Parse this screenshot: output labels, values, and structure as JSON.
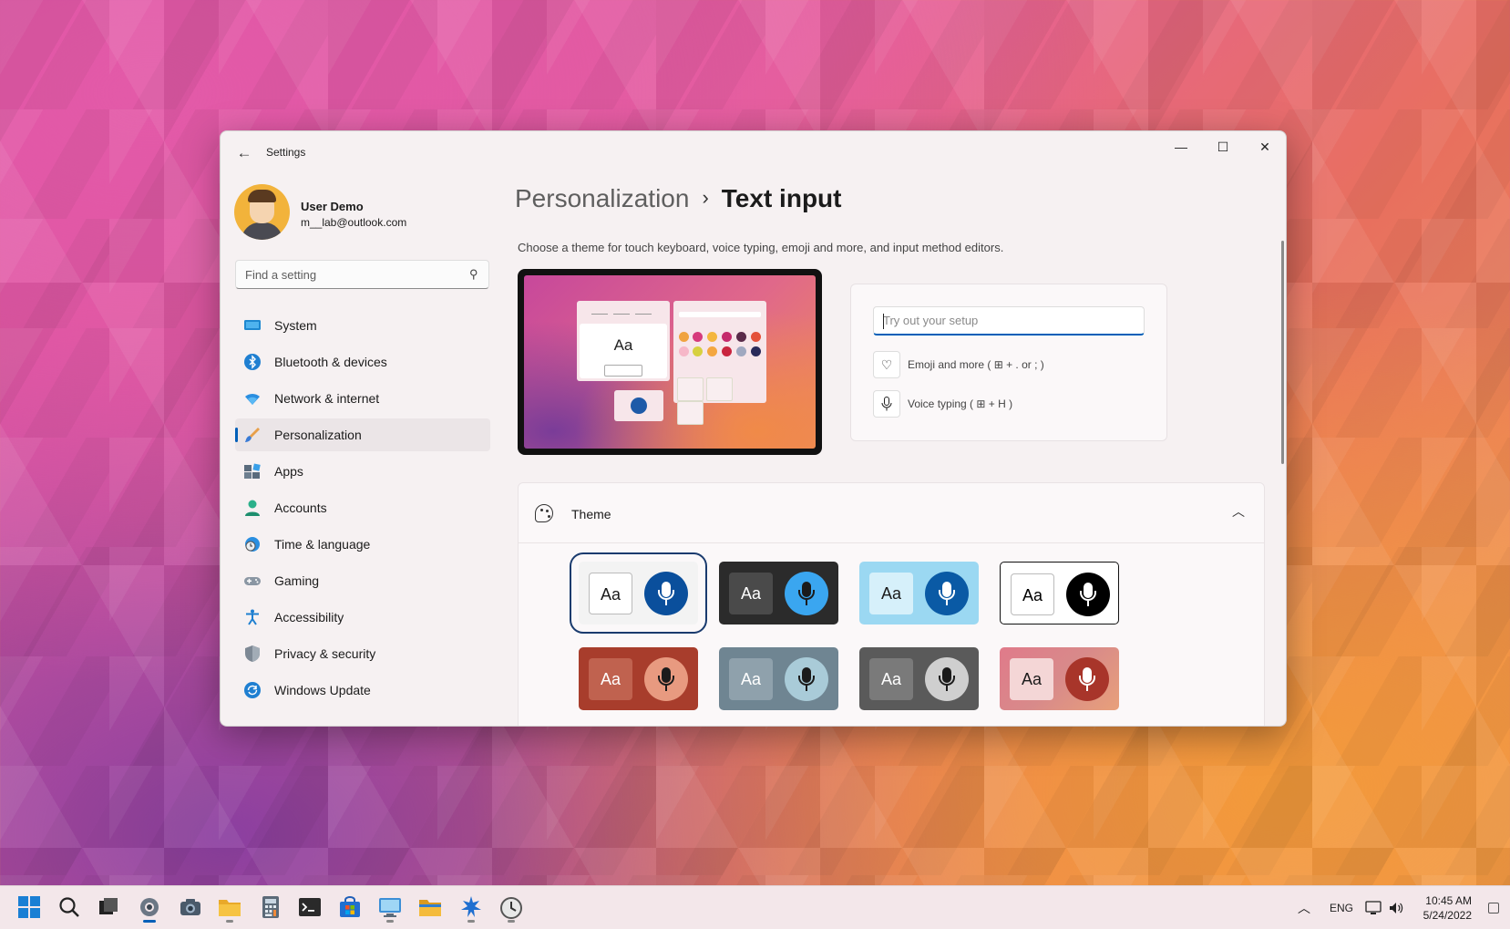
{
  "window": {
    "app_title": "Settings",
    "controls": {
      "minimize": "—",
      "maximize": "☐",
      "close": "✕"
    }
  },
  "user": {
    "name": "User Demo",
    "email": "m__lab@outlook.com"
  },
  "search": {
    "placeholder": "Find a setting"
  },
  "sidebar": {
    "items": [
      {
        "label": "System",
        "icon": "monitor-icon",
        "active": false
      },
      {
        "label": "Bluetooth & devices",
        "icon": "bluetooth-icon",
        "active": false
      },
      {
        "label": "Network & internet",
        "icon": "wifi-icon",
        "active": false
      },
      {
        "label": "Personalization",
        "icon": "brush-icon",
        "active": true
      },
      {
        "label": "Apps",
        "icon": "apps-icon",
        "active": false
      },
      {
        "label": "Accounts",
        "icon": "account-icon",
        "active": false
      },
      {
        "label": "Time & language",
        "icon": "globe-clock-icon",
        "active": false
      },
      {
        "label": "Gaming",
        "icon": "gamepad-icon",
        "active": false
      },
      {
        "label": "Accessibility",
        "icon": "accessibility-icon",
        "active": false
      },
      {
        "label": "Privacy & security",
        "icon": "shield-icon",
        "active": false
      },
      {
        "label": "Windows Update",
        "icon": "update-icon",
        "active": false
      }
    ]
  },
  "main": {
    "breadcrumb_parent": "Personalization",
    "breadcrumb_sep": "›",
    "breadcrumb_current": "Text input",
    "description": "Choose a theme for touch keyboard, voice typing, emoji and more, and input method editors.",
    "preview": {
      "sample_text": "Aa"
    },
    "tryout": {
      "placeholder": "Try out your setup",
      "emoji_label": "Emoji and more ( ⊞ + . or ; )",
      "voice_label": "Voice typing ( ⊞ + H )"
    },
    "theme": {
      "title": "Theme",
      "expanded": true,
      "swatches": [
        {
          "name": "light",
          "aa": "Aa",
          "bg": "#f3f3f3",
          "aa_bg": "#ffffff",
          "aa_fg": "#1b1b1b",
          "mic_bg": "#0a4f9c",
          "mic_fg": "#ffffff",
          "selected": true
        },
        {
          "name": "dark",
          "aa": "Aa",
          "bg": "#2b2b2b",
          "aa_bg": "#4a4a4a",
          "aa_fg": "#ffffff",
          "mic_bg": "#3aa6f0",
          "mic_fg": "#1b1b1b",
          "selected": false
        },
        {
          "name": "light-blue",
          "aa": "Aa",
          "bg": "#9bd8f2",
          "aa_bg": "#d6f0fa",
          "aa_fg": "#1b1b1b",
          "mic_bg": "#0a5aa5",
          "mic_fg": "#ffffff",
          "selected": false
        },
        {
          "name": "high-contrast",
          "aa": "Aa",
          "bg": "#ffffff",
          "aa_bg": "#ffffff",
          "aa_fg": "#000000",
          "mic_bg": "#000000",
          "mic_fg": "#ffffff",
          "selected": false
        },
        {
          "name": "rust",
          "aa": "Aa",
          "bg": "#a83d2c",
          "aa_bg": "#c0624f",
          "aa_fg": "#ffffff",
          "mic_bg": "#e89a80",
          "mic_fg": "#1b1b1b",
          "selected": false
        },
        {
          "name": "slate",
          "aa": "Aa",
          "bg": "#6f8592",
          "aa_bg": "#8fa1ac",
          "aa_fg": "#ffffff",
          "mic_bg": "#a9cbd8",
          "mic_fg": "#1b1b1b",
          "selected": false
        },
        {
          "name": "gray",
          "aa": "Aa",
          "bg": "#5a5a5a",
          "aa_bg": "#7a7a7a",
          "aa_fg": "#ffffff",
          "mic_bg": "#cfcfcf",
          "mic_fg": "#1b1b1b",
          "selected": false
        },
        {
          "name": "wallpaper",
          "aa": "Aa",
          "bg": "#d88a8a",
          "aa_bg": "#f4d6d6",
          "aa_fg": "#1b1b1b",
          "mic_bg": "#a8352a",
          "mic_fg": "#ffffff",
          "selected": false
        }
      ]
    }
  },
  "taskbar": {
    "apps": [
      "start-icon",
      "search-icon",
      "task-view-icon",
      "settings-icon",
      "camera-icon",
      "file-explorer-icon",
      "calculator-icon",
      "terminal-icon",
      "store-icon",
      "remote-desktop-icon",
      "folder-icon",
      "app-icon",
      "clock-app-icon"
    ],
    "tray_language": "ENG",
    "time": "10:45 AM",
    "date": "5/24/2022"
  },
  "colors": {
    "accent": "#005fb8"
  }
}
